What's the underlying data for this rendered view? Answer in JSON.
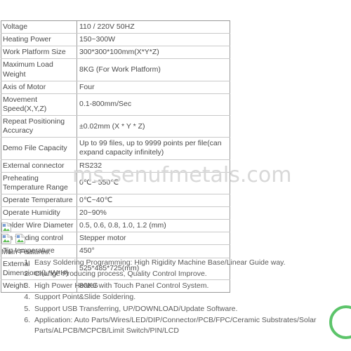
{
  "watermark": {
    "text": "ms.senufmetals.com"
  },
  "spec_table": {
    "rows": [
      {
        "key": "Voltage",
        "value": "110 / 220V 50HZ"
      },
      {
        "key": "Heating Power",
        "value": "150~300W"
      },
      {
        "key": "Work Platform Size",
        "value": "300*300*100mm(X*Y*Z)"
      },
      {
        "key": "Maximum Load Weight",
        "value": "8KG (For Work Platform)"
      },
      {
        "key": "Axis of Motor",
        "value": "Four"
      },
      {
        "key": "Movement Speed(X,Y,Z)",
        "value": "0.1-800mm/Sec"
      },
      {
        "key": "Repeat Positioning Accuracy",
        "value": "±0.02mm (X * Y * Z)"
      },
      {
        "key": "Demo File Capacity",
        "value": "Up to 99 files, up to 9999 points per file(can expand capacity infinitely)"
      },
      {
        "key": "External connector",
        "value": "RS232"
      },
      {
        "key": "Preheating Temperature Range",
        "value": "0℃~ 550℃"
      },
      {
        "key": "Operate Temperature",
        "value": "0℃~40℃"
      },
      {
        "key": "Operate Humidity",
        "value": "20~90%"
      },
      {
        "key": "Solder Wire Diameter",
        "value": "0.5, 0.6, 0.8, 1.0, 1.2 (mm)"
      },
      {
        "key": "Tin feeding control",
        "value": "Stepper motor"
      },
      {
        "key": "Tip temperature",
        "value": "450°"
      },
      {
        "key": "External Dimensions(L*W*H)",
        "value": "525*485*725(mm)"
      },
      {
        "key": "Weight",
        "value": "80KG"
      }
    ]
  },
  "broken_images": {
    "row1": [
      "broken-image-icon"
    ],
    "row2": [
      "broken-image-icon",
      "broken-image-icon"
    ]
  },
  "features": {
    "title": "Main Features:",
    "items": [
      "Easy Soldering Programming: High Rigidity Machine Base/Linear Guide way.",
      "Change Producing process, Quality Control Improve.",
      "High Power Heater with Touch Panel Control System.",
      "Support Point&Slide Soldering.",
      "Support USB Transferring, UP/DOWNLOAD/Update Software.",
      "Application: Auto Parts/Wires/LED/DIP/Connector/PCB/FPC/Ceramic Substrates/Solar Parts/ALPCB/MCPCB/Limit Switch/PIN/LCD"
    ]
  },
  "colors": {
    "text": "#4b4b4b",
    "table_border": "#9a9a9a",
    "table_inner_border": "#c9c9c9",
    "watermark": "#d8d8d8",
    "logo_green": "#5cc46a"
  }
}
